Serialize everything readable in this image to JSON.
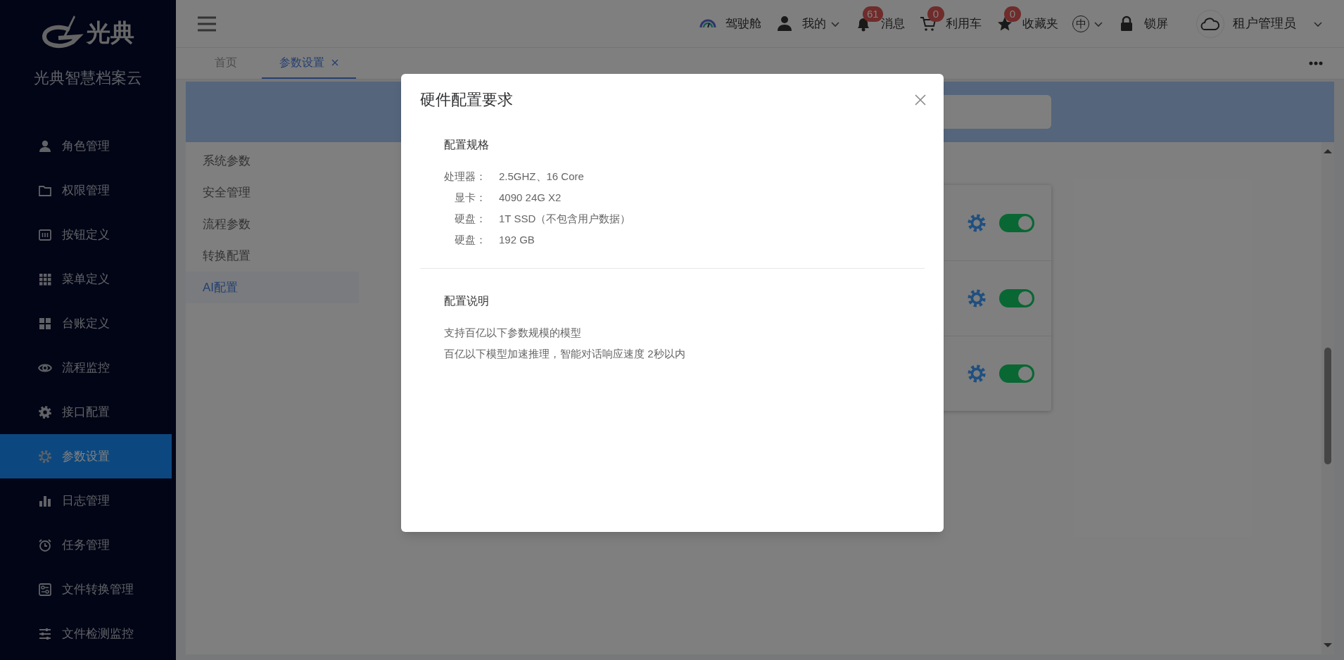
{
  "sidebar": {
    "logo_text": "光典",
    "app_name": "光典智慧档案云",
    "items": [
      {
        "label": "角色管理",
        "selected": false
      },
      {
        "label": "权限管理",
        "selected": false
      },
      {
        "label": "按钮定义",
        "selected": false
      },
      {
        "label": "菜单定义",
        "selected": false
      },
      {
        "label": "台账定义",
        "selected": false
      },
      {
        "label": "流程监控",
        "selected": false
      },
      {
        "label": "接口配置",
        "selected": false
      },
      {
        "label": "参数设置",
        "selected": true
      },
      {
        "label": "日志管理",
        "selected": false
      },
      {
        "label": "任务管理",
        "selected": false
      },
      {
        "label": "文件转换管理",
        "selected": false
      },
      {
        "label": "文件检测监控",
        "selected": false
      }
    ]
  },
  "header": {
    "items": [
      {
        "kind": "link",
        "label": "驾驶舱",
        "dropdown": false
      },
      {
        "kind": "link",
        "label": "我的",
        "dropdown": true
      },
      {
        "kind": "link",
        "label": "消息",
        "badge": "61",
        "dropdown": false
      },
      {
        "kind": "link",
        "label": "利用车",
        "badge": "0",
        "dropdown": false
      },
      {
        "kind": "link",
        "label": "收藏夹",
        "badge": "0",
        "dropdown": false
      },
      {
        "kind": "language",
        "label": "中",
        "dropdown": true
      },
      {
        "kind": "link",
        "label": "锁屏",
        "dropdown": false
      }
    ],
    "user": {
      "name": "租户管理员"
    }
  },
  "tabs": [
    {
      "label": "首页",
      "selected": false,
      "closable": false
    },
    {
      "label": "参数设置",
      "selected": true,
      "closable": true
    }
  ],
  "settings_menu": [
    {
      "label": "系统参数",
      "selected": false
    },
    {
      "label": "安全管理",
      "selected": false
    },
    {
      "label": "流程参数",
      "selected": false
    },
    {
      "label": "转换配置",
      "selected": false
    },
    {
      "label": "AI配置",
      "selected": true
    }
  ],
  "feature_cards": [
    {
      "on": true
    },
    {
      "on": true
    },
    {
      "on": true
    }
  ],
  "dialog": {
    "title": "硬件配置要求",
    "sections": [
      {
        "kind": "specs",
        "heading": "配置规格",
        "rows": [
          {
            "label": "处理器：",
            "value": "2.5GHZ、16 Core"
          },
          {
            "label": "显卡：",
            "value": "4090 24G X2"
          },
          {
            "label": "硬盘：",
            "value": "1T SSD（不包含用户数据）"
          },
          {
            "label": "硬盘：",
            "value": "192 GB"
          }
        ]
      },
      {
        "kind": "notes",
        "heading": "配置说明",
        "lines": [
          "支持百亿以下参数规模的模型",
          "百亿以下模型加速推理，智能对话响应速度 2秒以内"
        ]
      }
    ]
  }
}
